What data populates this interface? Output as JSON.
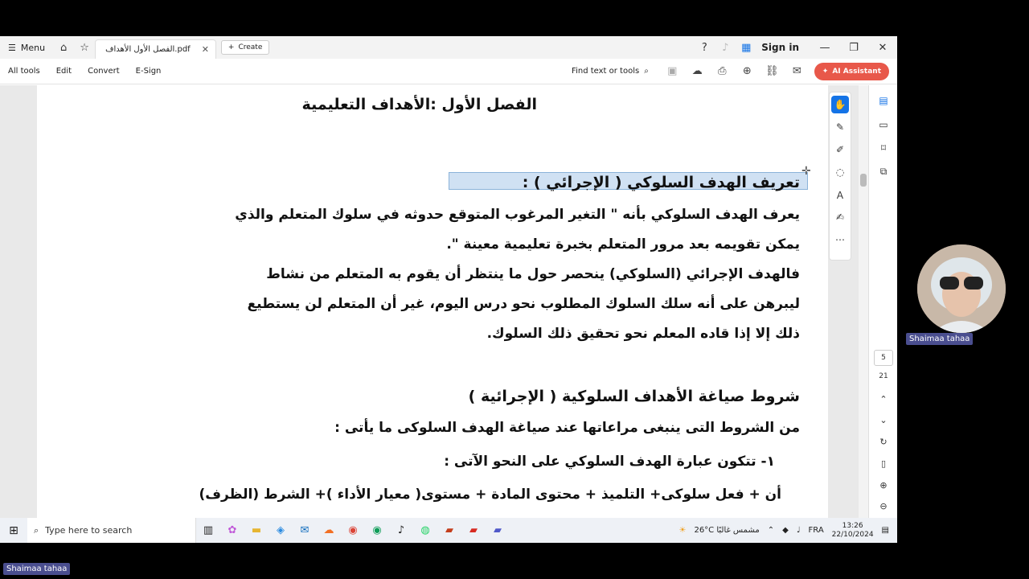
{
  "titlebar": {
    "menu_label": "Menu",
    "tab_title": "الفصل الأول  الأهداف.pdf",
    "create_label": "Create",
    "signin_label": "Sign in"
  },
  "toolbar": {
    "all_tools": "All tools",
    "edit": "Edit",
    "convert": "Convert",
    "esign": "E-Sign",
    "find_label": "Find text or tools",
    "ai_label": "AI Assistant"
  },
  "document": {
    "title": "الفصل الأول :الأهداف التعليمية",
    "section1_heading": "تعريف الهدف السلوكي ( الإجرائي ) :",
    "para1_line1": "يعرف الهدف السلوكي بأنه \" التغير المرغوب المتوقع حدوثه في سلوك المتعلم والذي",
    "para1_line2": "يمكن تقويمه بعد مرور المتعلم بخبرة تعليمية معينة \".",
    "para2_line1": "فالهدف الإجرائي (السلوكي) ينحصر حول ما ينتظر أن يقوم به المتعلم من نشاط",
    "para2_line2": "ليبرهن على أنه سلك السلوك المطلوب نحو درس اليوم، غير أن المتعلم لن يستطيع",
    "para2_line3": "ذلك إلا إذا قاده المعلم نحو تحقيق ذلك السلوك.",
    "section2_heading": "شروط صياغة الأهداف السلوكية ( الإجرائية )",
    "para3_line1": "من الشروط التى ينبغى مراعاتها عند صياغة الهدف السلوكى ما يأتى :",
    "item1": "١-   تتكون  عبارة الهدف السلوكي على النحو الآتى :",
    "formula": "أن + فعل سلوكى+ التلميذ + محتوى المادة + مستوى( معيار الأداء )+ الشرط (الظرف)"
  },
  "navigation": {
    "current_page": "5",
    "total_pages": "21"
  },
  "taskbar": {
    "search_placeholder": "Type here to search",
    "weather": "26°C  مشمس غالبًا",
    "language": "FRA",
    "time": "13:26",
    "date": "22/10/2024"
  },
  "participants": {
    "webcam_name": "Shaimaa tahaa",
    "self_name": "Shaimaa tahaa"
  },
  "colors": {
    "accent": "#1473e6",
    "ai_button": "#e8584a",
    "name_tag": "#4a4e8f"
  }
}
